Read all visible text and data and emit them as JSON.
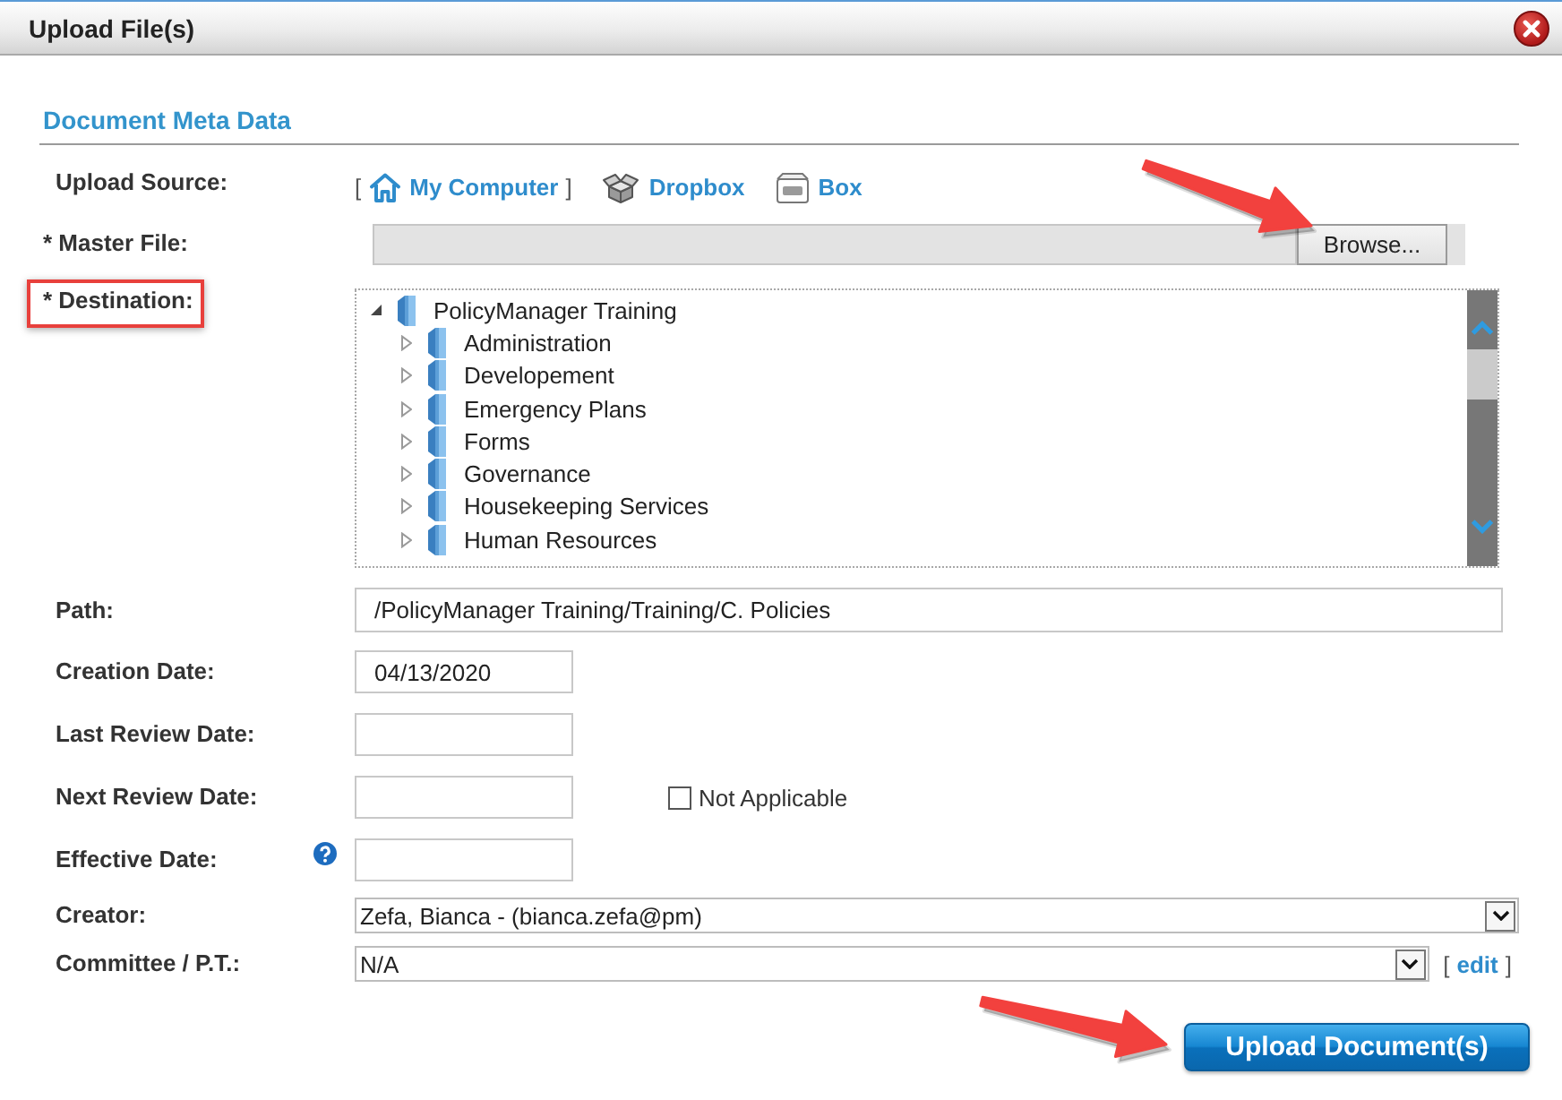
{
  "window": {
    "title": "Upload File(s)"
  },
  "section": {
    "title": "Document Meta Data"
  },
  "upload_source": {
    "label": "Upload Source:",
    "selection_marks": [
      "[",
      "]"
    ],
    "options": [
      {
        "kind": "home",
        "label": "My Computer",
        "selected": true
      },
      {
        "kind": "package",
        "label": "Dropbox",
        "selected": false
      },
      {
        "kind": "tile",
        "label": "Box",
        "selected": false
      }
    ]
  },
  "master_file": {
    "label": "* Master File:",
    "required": true,
    "button": "Browse...",
    "callout_arrow": true
  },
  "destination": {
    "label": "* Destination:",
    "required": true,
    "highlighted": true,
    "tree": [
      {
        "label": "PolicyManager Training",
        "expanded": true,
        "children": [
          {
            "label": "Administration",
            "expanded": false
          },
          {
            "label": "Developement",
            "expanded": false
          },
          {
            "label": "Emergency Plans",
            "expanded": false
          },
          {
            "label": "Forms",
            "expanded": false
          },
          {
            "label": "Governance",
            "expanded": false
          },
          {
            "label": "Housekeeping Services",
            "expanded": false
          },
          {
            "label": "Human Resources",
            "expanded": false
          }
        ]
      }
    ]
  },
  "fields": [
    {
      "kind": "text",
      "label": "Path:",
      "value": "/PolicyManager Training/Training/C. Policies"
    },
    {
      "kind": "date",
      "label": "Creation Date:",
      "value": "04/13/2020"
    },
    {
      "kind": "date",
      "label": "Last Review Date:"
    },
    {
      "kind": "date",
      "label": "Next Review Date:",
      "checkbox": {
        "label": "Not Applicable",
        "checked": false
      }
    },
    {
      "kind": "date",
      "label": "Effective Date:",
      "help": true
    },
    {
      "kind": "select",
      "label": "Creator:",
      "value": "Zefa, Bianca - (bianca.zefa@pm)"
    },
    {
      "kind": "select",
      "label": "Committee / P.T.:",
      "value": "N/A",
      "link": {
        "label": "edit",
        "marks": [
          "[",
          "]"
        ]
      }
    }
  ],
  "submit": {
    "label": "Upload Document(s)",
    "callout_arrow": true
  }
}
